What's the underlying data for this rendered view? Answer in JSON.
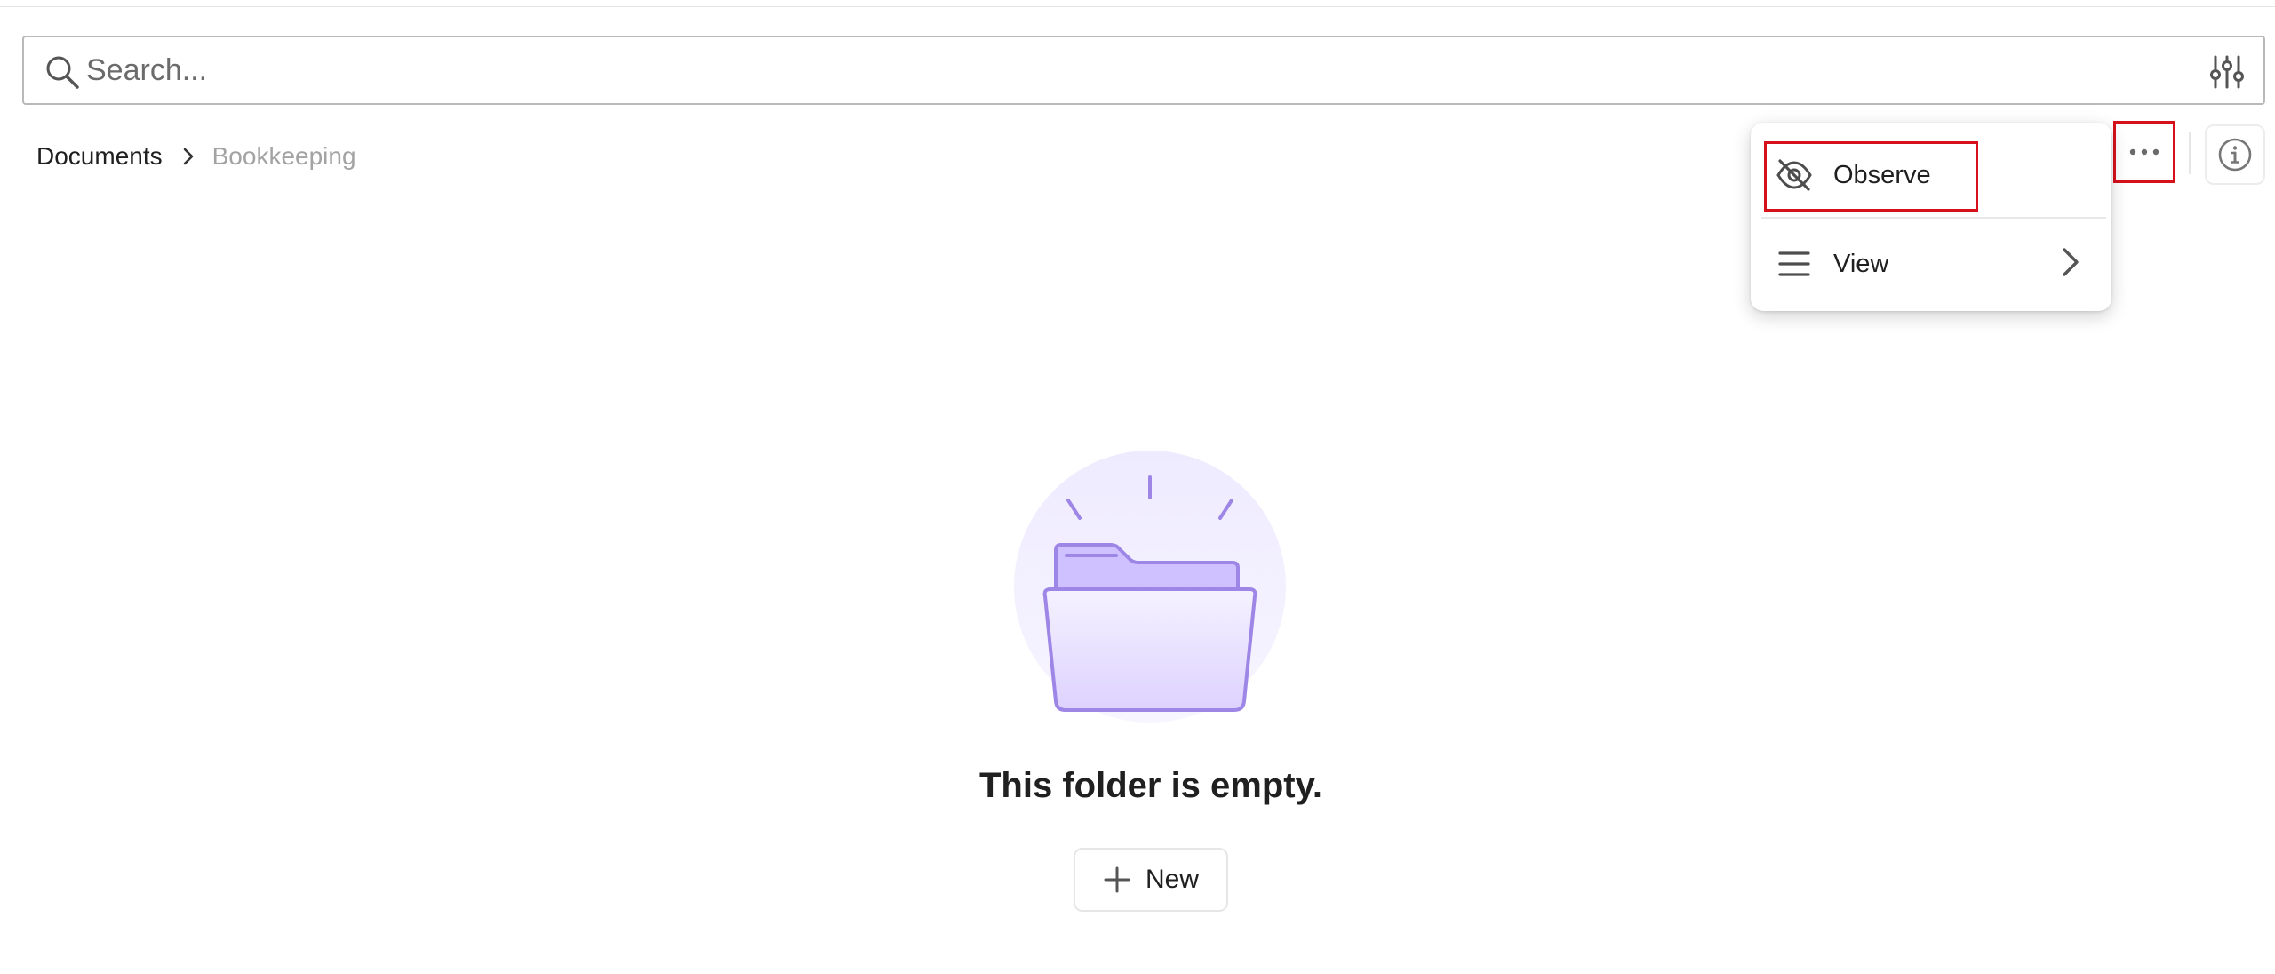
{
  "search": {
    "placeholder": "Search...",
    "icon": "search-icon",
    "filter_icon": "sliders-icon"
  },
  "breadcrumb": {
    "root": "Documents",
    "current": "Bookkeeping"
  },
  "toolbar": {
    "more_icon": "more-horizontal-icon",
    "info_icon": "info-icon"
  },
  "menu": {
    "items": [
      {
        "label": "Observe",
        "icon": "eye-off-icon"
      },
      {
        "label": "View",
        "icon": "list-icon",
        "submenu": true
      }
    ]
  },
  "empty_state": {
    "title": "This folder is empty.",
    "illustration": "empty-folder-illustration",
    "new_label": "New"
  },
  "colors": {
    "highlight": "#d6111c",
    "accent_purple": "#9d86e6",
    "folder_fill": "#cfc1ff"
  }
}
